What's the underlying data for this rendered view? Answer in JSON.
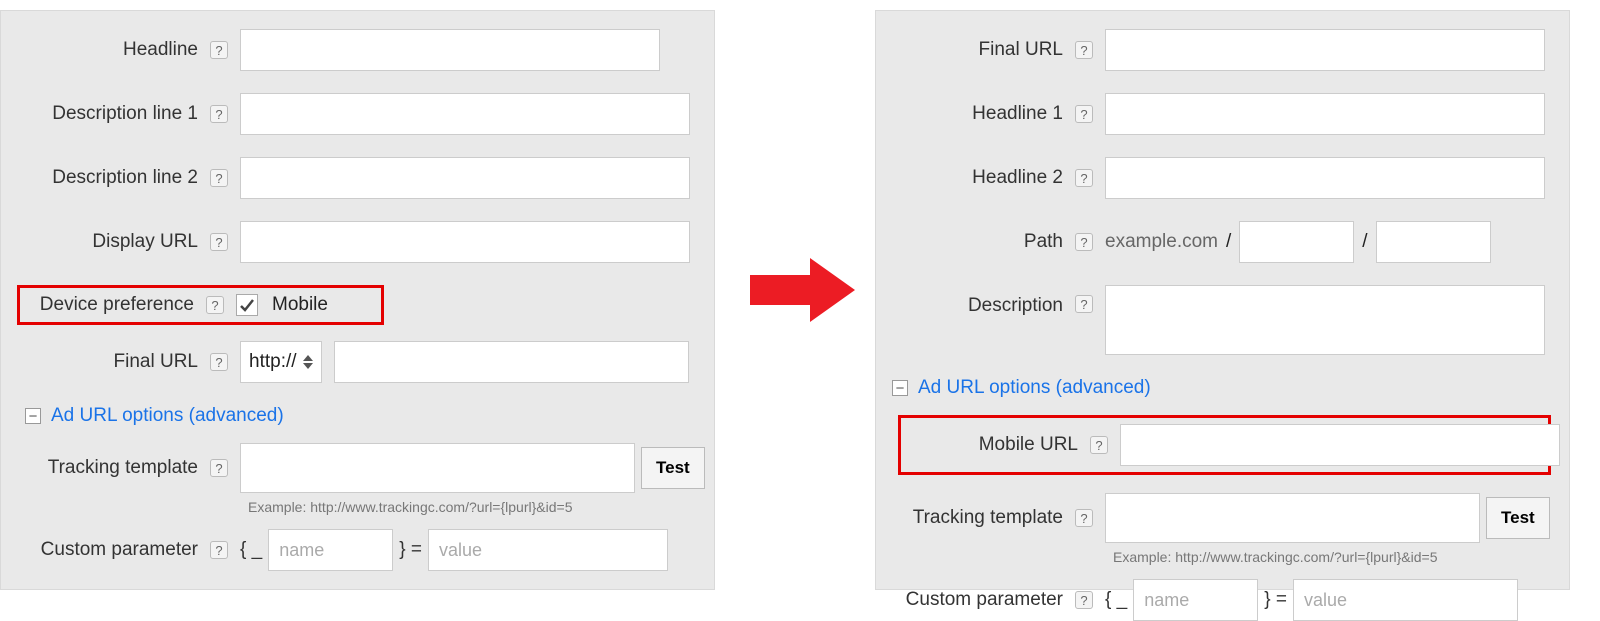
{
  "left": {
    "headline_label": "Headline",
    "desc1_label": "Description line 1",
    "desc2_label": "Description line 2",
    "display_url_label": "Display URL",
    "device_pref_label": "Device preference",
    "device_mobile_label": "Mobile",
    "device_mobile_checked": true,
    "final_url_label": "Final URL",
    "proto_value": "http://",
    "accordion_label": "Ad URL options (advanced)",
    "tracking_label": "Tracking template",
    "tracking_hint": "Example: http://www.trackingc.com/?url={lpurl}&id=5",
    "test_button": "Test",
    "custom_param_label": "Custom parameter",
    "custom_name_placeholder": "name",
    "custom_value_placeholder": "value",
    "brace_open": "{ _",
    "brace_close": "} ="
  },
  "right": {
    "final_url_label": "Final URL",
    "headline1_label": "Headline 1",
    "headline2_label": "Headline 2",
    "path_label": "Path",
    "path_domain": "example.com",
    "path_sep": "/",
    "description_label": "Description",
    "accordion_label": "Ad URL options (advanced)",
    "mobile_url_label": "Mobile URL",
    "tracking_label": "Tracking template",
    "tracking_hint": "Example: http://www.trackingc.com/?url={lpurl}&id=5",
    "test_button": "Test",
    "custom_param_label": "Custom parameter",
    "custom_name_placeholder": "name",
    "custom_value_placeholder": "value",
    "brace_open": "{ _",
    "brace_close": "} ="
  },
  "help_glyph": "?",
  "minus_glyph": "−"
}
